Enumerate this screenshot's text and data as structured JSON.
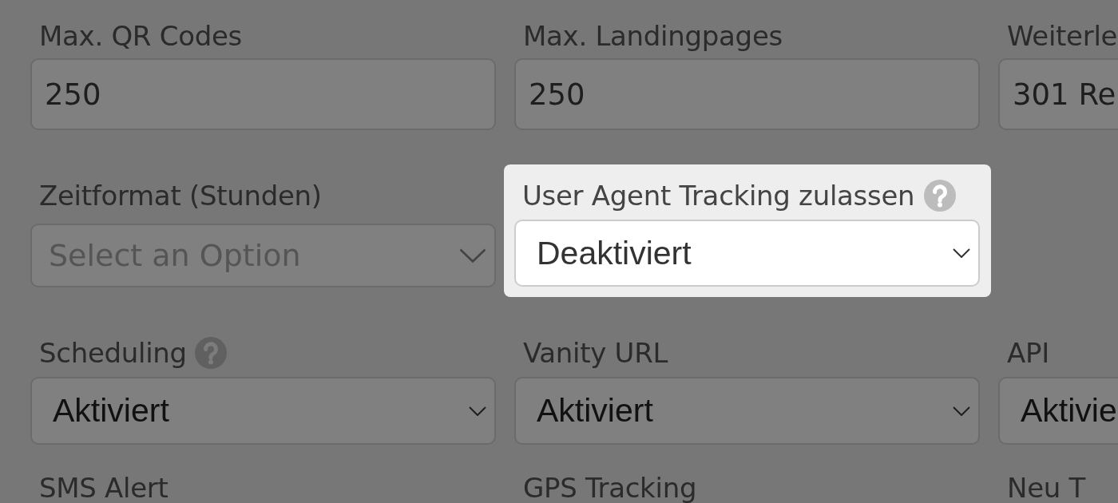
{
  "rows": [
    [
      {
        "label": "Max. QR Codes",
        "help_icon": false,
        "highlighted": false,
        "control": {
          "kind": "input",
          "value": "250"
        }
      },
      {
        "label": "Max. Landingpages",
        "help_icon": false,
        "highlighted": false,
        "control": {
          "kind": "input",
          "value": "250"
        }
      },
      {
        "label": "Weiterle",
        "help_icon": false,
        "highlighted": false,
        "control": {
          "kind": "input",
          "value": "301 Re"
        }
      }
    ],
    [
      {
        "label": "Zeitformat (Stunden)",
        "help_icon": false,
        "highlighted": false,
        "control": {
          "kind": "combo",
          "placeholder": "Select an Option"
        }
      },
      {
        "label": "User Agent Tracking zulassen",
        "help_icon": true,
        "highlighted": true,
        "control": {
          "kind": "select",
          "value": "Deaktiviert"
        }
      }
    ],
    [
      {
        "label": "Scheduling",
        "help_icon": true,
        "highlighted": false,
        "control": {
          "kind": "select",
          "value": "Aktiviert"
        }
      },
      {
        "label": "Vanity URL",
        "help_icon": false,
        "highlighted": false,
        "control": {
          "kind": "select",
          "value": "Aktiviert"
        }
      },
      {
        "label": "API",
        "help_icon": false,
        "highlighted": false,
        "control": {
          "kind": "select",
          "value": "Aktivie"
        }
      }
    ],
    [
      {
        "label": "SMS Alert",
        "help_icon": false,
        "highlighted": false
      },
      {
        "label": "GPS Tracking",
        "help_icon": false,
        "highlighted": false
      },
      {
        "label": "Neu T",
        "help_icon": false,
        "highlighted": false
      }
    ]
  ]
}
